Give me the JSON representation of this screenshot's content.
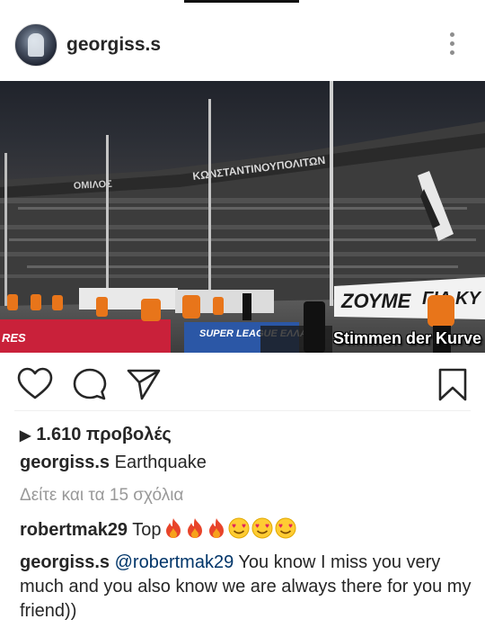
{
  "post": {
    "username": "georgiss.s",
    "media": {
      "banner_text": "ΚΩΝΣΤΑΝΤΙΝΟΥΠΟΛΙΤΩΝ",
      "banner_prefix": "ΟΜΙΛΟΣ",
      "ad_board": "SUPER LEAGUE ΕΛΛΑΔΑ",
      "watermark": "Stimmen der Kurve"
    },
    "views_label": "1.610 προβολές",
    "caption": {
      "username": "georgiss.s",
      "text": "Earthquake"
    },
    "view_all_comments": "Δείτε και τα 15 σχόλια",
    "comments": [
      {
        "username": "robertmak29",
        "text": "Top",
        "emojis": [
          "fire",
          "fire",
          "fire",
          "heart-eyes",
          "heart-eyes",
          "heart-eyes"
        ]
      },
      {
        "username": "georgiss.s",
        "mention": "@robertmak29",
        "text": "You know I miss you very much and you also know we are always there for you my friend))"
      }
    ]
  },
  "colors": {
    "text": "#262626",
    "muted": "#999999",
    "icon": "#262626",
    "link": "#003569"
  }
}
